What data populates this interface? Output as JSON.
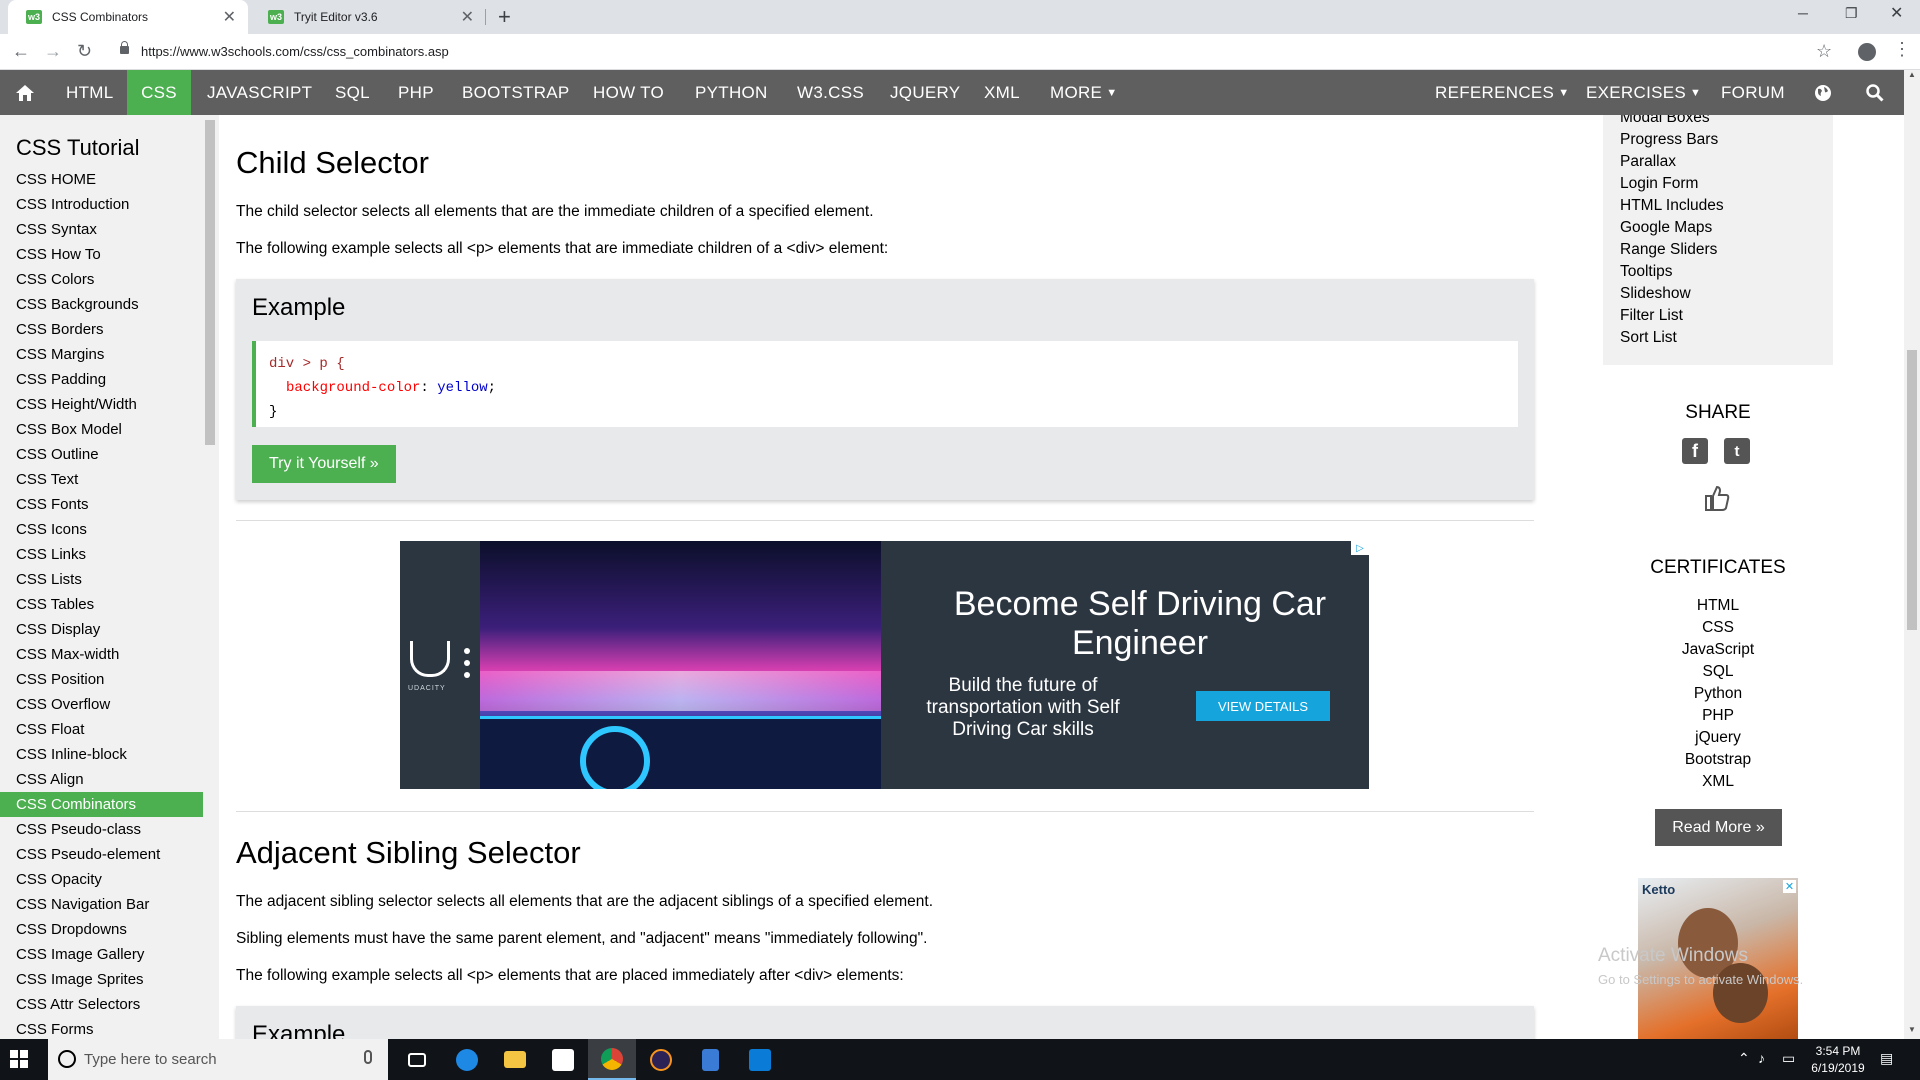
{
  "browser": {
    "tabs": [
      {
        "title": "CSS Combinators",
        "favicon": "w3"
      },
      {
        "title": "Tryit Editor v3.6",
        "favicon": "w3"
      }
    ],
    "url": "https://www.w3schools.com/css/css_combinators.asp"
  },
  "topnav": {
    "items": [
      "HTML",
      "CSS",
      "JAVASCRIPT",
      "SQL",
      "PHP",
      "BOOTSTRAP",
      "HOW TO",
      "PYTHON",
      "W3.CSS",
      "JQUERY",
      "XML",
      "MORE"
    ],
    "active": "CSS",
    "right_items": [
      "REFERENCES",
      "EXERCISES",
      "FORUM"
    ]
  },
  "sidebar": {
    "title": "CSS Tutorial",
    "items": [
      "CSS HOME",
      "CSS Introduction",
      "CSS Syntax",
      "CSS How To",
      "CSS Colors",
      "CSS Backgrounds",
      "CSS Borders",
      "CSS Margins",
      "CSS Padding",
      "CSS Height/Width",
      "CSS Box Model",
      "CSS Outline",
      "CSS Text",
      "CSS Fonts",
      "CSS Icons",
      "CSS Links",
      "CSS Lists",
      "CSS Tables",
      "CSS Display",
      "CSS Max-width",
      "CSS Position",
      "CSS Overflow",
      "CSS Float",
      "CSS Inline-block",
      "CSS Align",
      "CSS Combinators",
      "CSS Pseudo-class",
      "CSS Pseudo-element",
      "CSS Opacity",
      "CSS Navigation Bar",
      "CSS Dropdowns",
      "CSS Image Gallery",
      "CSS Image Sprites",
      "CSS Attr Selectors",
      "CSS Forms"
    ],
    "active": "CSS Combinators"
  },
  "main": {
    "child": {
      "heading": "Child Selector",
      "p1": "The child selector selects all elements that are the immediate children of a specified element.",
      "p2": "The following example selects all <p> elements that are immediate children of a <div> element:",
      "example_title": "Example",
      "code_sel": "div > p {",
      "code_prop": "background-color",
      "code_colon": ": ",
      "code_val": "yellow",
      "code_semi": ";",
      "code_close": "}",
      "tryit": "Try it Yourself »"
    },
    "ad": {
      "brand": "UDACITY",
      "headline": "Become Self Driving Car Engineer",
      "sub": "Build the future of transportation with Self Driving Car skills",
      "cta": "VIEW DETAILS"
    },
    "adjacent": {
      "heading": "Adjacent Sibling Selector",
      "p1": "The adjacent sibling selector selects all elements that are the adjacent siblings of a specified element.",
      "p2": "Sibling elements must have the same parent element, and \"adjacent\" means \"immediately following\".",
      "p3": "The following example selects all <p> elements that are placed immediately after <div> elements:",
      "example_title": "Example"
    }
  },
  "right": {
    "links": [
      "Modal Boxes",
      "Progress Bars",
      "Parallax",
      "Login Form",
      "HTML Includes",
      "Google Maps",
      "Range Sliders",
      "Tooltips",
      "Slideshow",
      "Filter List",
      "Sort List"
    ],
    "share_title": "SHARE",
    "certificates_title": "CERTIFICATES",
    "certificates": [
      "HTML",
      "CSS",
      "JavaScript",
      "SQL",
      "Python",
      "PHP",
      "jQuery",
      "Bootstrap",
      "XML"
    ],
    "read_more": "Read More »",
    "ad_brand": "Ketto",
    "watermark_title": "Activate Windows",
    "watermark_sub": "Go to Settings to activate Windows."
  },
  "taskbar": {
    "search_placeholder": "Type here to search",
    "time": "3:54 PM",
    "date": "6/19/2019"
  },
  "colors": {
    "accent": "#4CAF50",
    "nav_bg": "#5f5f5f",
    "sidebar_bg": "#f1f1f1"
  }
}
